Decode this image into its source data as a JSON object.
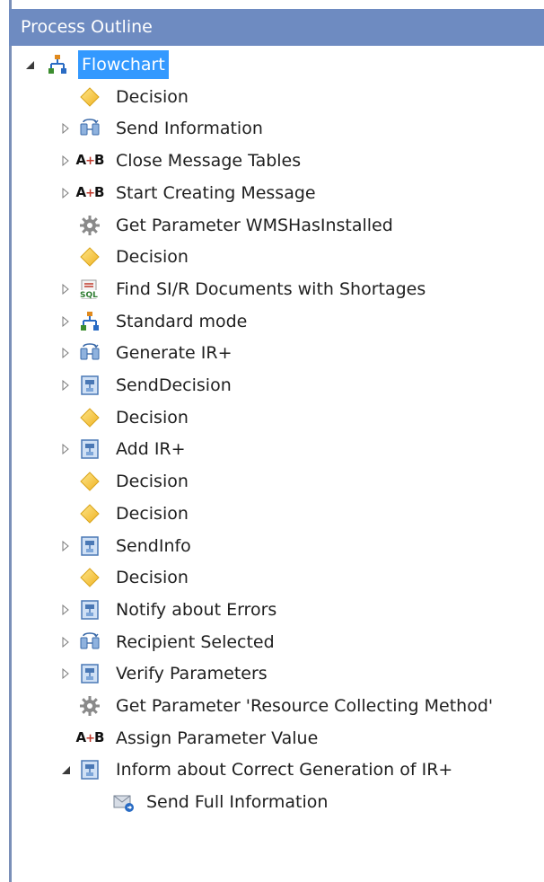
{
  "panel": {
    "title": "Process Outline"
  },
  "tree": {
    "root": {
      "label": "Flowchart",
      "icon": "flowchart-icon",
      "expanded": true,
      "selected": true
    },
    "items": [
      {
        "label": "Decision",
        "icon": "decision-diamond-icon",
        "expander": "none"
      },
      {
        "label": "Send Information",
        "icon": "group-icon",
        "expander": "collapsed"
      },
      {
        "label": "Close Message Tables",
        "icon": "assign-ab-icon",
        "expander": "collapsed"
      },
      {
        "label": "Start Creating Message",
        "icon": "assign-ab-icon",
        "expander": "collapsed"
      },
      {
        "label": "Get Parameter WMSHasInstalled",
        "icon": "gear-icon",
        "expander": "none"
      },
      {
        "label": "Decision",
        "icon": "decision-diamond-icon",
        "expander": "none"
      },
      {
        "label": "Find SI/R Documents with Shortages",
        "icon": "sql-icon",
        "expander": "collapsed"
      },
      {
        "label": "Standard mode",
        "icon": "flowchart-icon",
        "expander": "collapsed"
      },
      {
        "label": "Generate IR+",
        "icon": "group-icon",
        "expander": "collapsed"
      },
      {
        "label": "SendDecision",
        "icon": "sequence-icon",
        "expander": "collapsed"
      },
      {
        "label": "Decision",
        "icon": "decision-diamond-icon",
        "expander": "none"
      },
      {
        "label": "Add IR+",
        "icon": "sequence-icon",
        "expander": "collapsed"
      },
      {
        "label": "Decision",
        "icon": "decision-diamond-icon",
        "expander": "none"
      },
      {
        "label": "Decision",
        "icon": "decision-diamond-icon",
        "expander": "none"
      },
      {
        "label": "SendInfo",
        "icon": "sequence-icon",
        "expander": "collapsed"
      },
      {
        "label": "Decision",
        "icon": "decision-diamond-icon",
        "expander": "none"
      },
      {
        "label": "Notify about Errors",
        "icon": "sequence-icon",
        "expander": "collapsed"
      },
      {
        "label": "Recipient Selected",
        "icon": "group-icon",
        "expander": "collapsed"
      },
      {
        "label": "Verify Parameters",
        "icon": "sequence-icon",
        "expander": "collapsed"
      },
      {
        "label": "Get Parameter 'Resource Collecting Method'",
        "icon": "gear-icon",
        "expander": "none"
      },
      {
        "label": "Assign Parameter Value",
        "icon": "assign-ab-icon",
        "expander": "none"
      },
      {
        "label": "Inform about Correct Generation of IR+",
        "icon": "sequence-icon",
        "expander": "expanded"
      }
    ],
    "child_items": [
      {
        "label": "Send Full Information",
        "icon": "send-mail-icon",
        "expander": "none"
      }
    ]
  },
  "colors": {
    "titlebar": "#6e8bc1",
    "selection": "#3399ff",
    "diamond": "#f5c842",
    "frame": "#7a8fb8"
  }
}
